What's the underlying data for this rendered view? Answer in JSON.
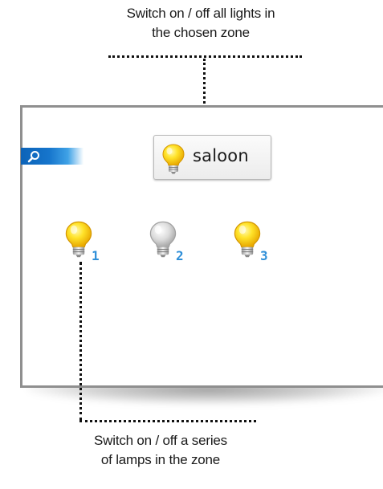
{
  "annotations": {
    "top_caption": [
      "Switch on / off all lights in",
      "the chosen zone"
    ],
    "bottom_caption": [
      "Switch on / off a series",
      "of lamps in the zone"
    ]
  },
  "zone_button": {
    "label": "saloon",
    "icon": "lightbulb-on-icon"
  },
  "search": {
    "icon": "magnifier-icon"
  },
  "lamps": [
    {
      "number": "1",
      "state": "on",
      "icon": "lightbulb-on-icon"
    },
    {
      "number": "2",
      "state": "off",
      "icon": "lightbulb-off-icon"
    },
    {
      "number": "3",
      "state": "on",
      "icon": "lightbulb-on-icon"
    }
  ],
  "colors": {
    "bulb_on": "#f7c800",
    "bulb_off": "#cfcfcf",
    "lamp_number": "#2f8fd8",
    "search_bar": "#0c63b8",
    "panel_border": "#8f8f8f"
  }
}
